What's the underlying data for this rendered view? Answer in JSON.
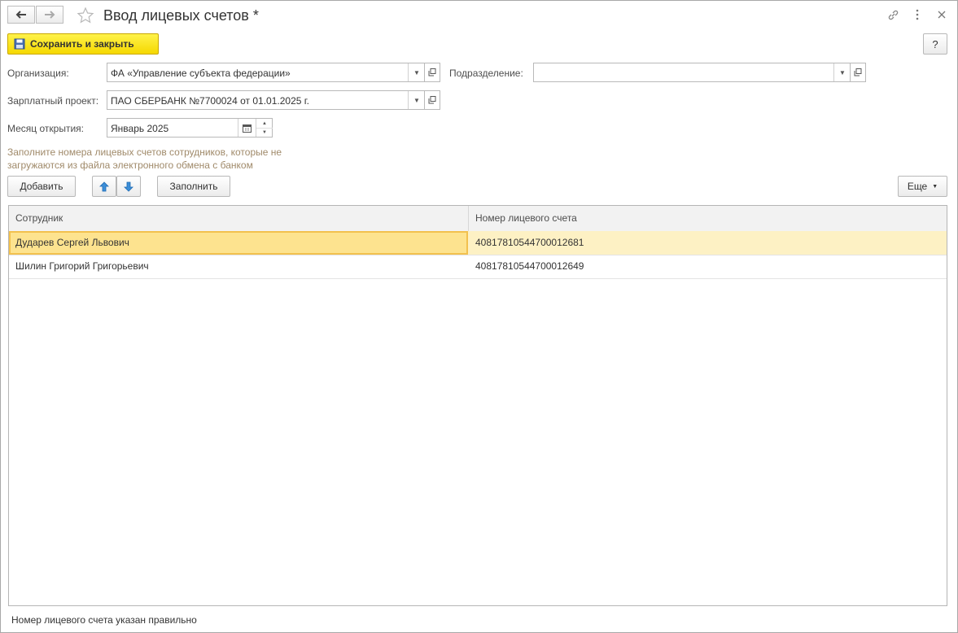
{
  "window": {
    "title": "Ввод лицевых счетов *",
    "help_label": "?"
  },
  "toolbar": {
    "save_close_label": "Сохранить и закрыть"
  },
  "form": {
    "organization_label": "Организация:",
    "organization_value": "ФА «Управление субъекта федерации»",
    "subdivision_label": "Подразделение:",
    "subdivision_value": "",
    "salary_project_label": "Зарплатный проект:",
    "salary_project_value": "ПАО СБЕРБАНК №7700024 от 01.01.2025 г.",
    "open_month_label": "Месяц открытия:",
    "open_month_value": "Январь 2025"
  },
  "hint": {
    "line1": "Заполните номера лицевых счетов сотрудников, которые не",
    "line2": "загружаются из файла электронного обмена с банком"
  },
  "table_toolbar": {
    "add_label": "Добавить",
    "fill_label": "Заполнить",
    "more_label": "Еще"
  },
  "table": {
    "columns": [
      "Сотрудник",
      "Номер лицевого счета"
    ],
    "rows": [
      {
        "employee": "Дударев Сергей Львович",
        "account": "40817810544700012681"
      },
      {
        "employee": "Шилин Григорий Григорьевич",
        "account": "40817810544700012649"
      }
    ]
  },
  "status_bar": {
    "message": "Номер лицевого счета указан правильно"
  },
  "colors": {
    "accent_yellow": "#f5d800",
    "selected_row": "#fdf1c4",
    "selected_cell": "#fde38f",
    "hint_text": "#a08a6a"
  }
}
